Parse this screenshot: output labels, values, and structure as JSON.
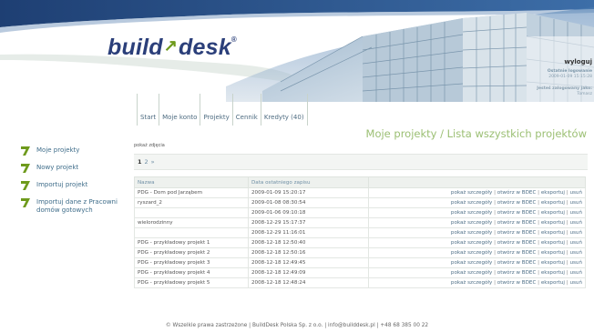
{
  "brand": {
    "logo_main": "build",
    "logo_tick": "↗",
    "logo_end": "desk",
    "logo_reg": "®"
  },
  "user": {
    "logout": "wyloguj",
    "last_login_label": "Ostatnie logowanie",
    "last_login_value": "2009-01-09 15:15:28",
    "logged_as_label": "Jesteś zalogowany jako:",
    "logged_as_value": "Tomasz"
  },
  "nav": [
    "Start",
    "Moje konto",
    "Projekty",
    "Cennik",
    "Kredyty (40)"
  ],
  "page_title": "Moje projekty / Lista wszystkich projektów",
  "sidebar": [
    {
      "label": "Moje projekty"
    },
    {
      "label": "Nowy projekt"
    },
    {
      "label": "Importuj projekt"
    },
    {
      "label": "Importuj dane z Pracowni domów gotowych"
    }
  ],
  "main": {
    "show_hidden": "pokaż zdjęcia",
    "pager": {
      "current": "1",
      "next": "2",
      "arrow": "»"
    },
    "columns": [
      "Nazwa",
      "Data ostatniego zapisu",
      ""
    ],
    "actions": [
      "pokaż szczegóły",
      "otwórz w BDEC",
      "eksportuj",
      "usuń"
    ],
    "rows": [
      {
        "name": "PDG - Dom pod Jarząbem",
        "date": "2009-01-09 15:20:17"
      },
      {
        "name": "ryszard_2",
        "date": "2009-01-08 08:30:54"
      },
      {
        "name": "",
        "date": "2009-01-06 09:10:18"
      },
      {
        "name": "wielorodzinny",
        "date": "2008-12-29 15:17:37"
      },
      {
        "name": "",
        "date": "2008-12-29 11:16:01"
      },
      {
        "name": "PDG - przykładowy projekt 1",
        "date": "2008-12-18 12:50:40"
      },
      {
        "name": "PDG - przykładowy projekt 2",
        "date": "2008-12-18 12:50:16"
      },
      {
        "name": "PDG - przykładowy projekt 3",
        "date": "2008-12-18 12:49:45"
      },
      {
        "name": "PDG - przykładowy projekt 4",
        "date": "2008-12-18 12:49:09"
      },
      {
        "name": "PDG - przykładowy projekt 5",
        "date": "2008-12-18 12:48:24"
      }
    ]
  },
  "footer": "© Wszelkie prawa zastrzeżone | BuildDesk Polska Sp. z o.o. | info@builddesk.pl | +48 68 385 00 22",
  "colors": {
    "brand_blue": "#2b3f7a",
    "brand_green": "#6e9a1c",
    "title_green": "#9bbf73",
    "link_blue": "#4e6f87"
  }
}
